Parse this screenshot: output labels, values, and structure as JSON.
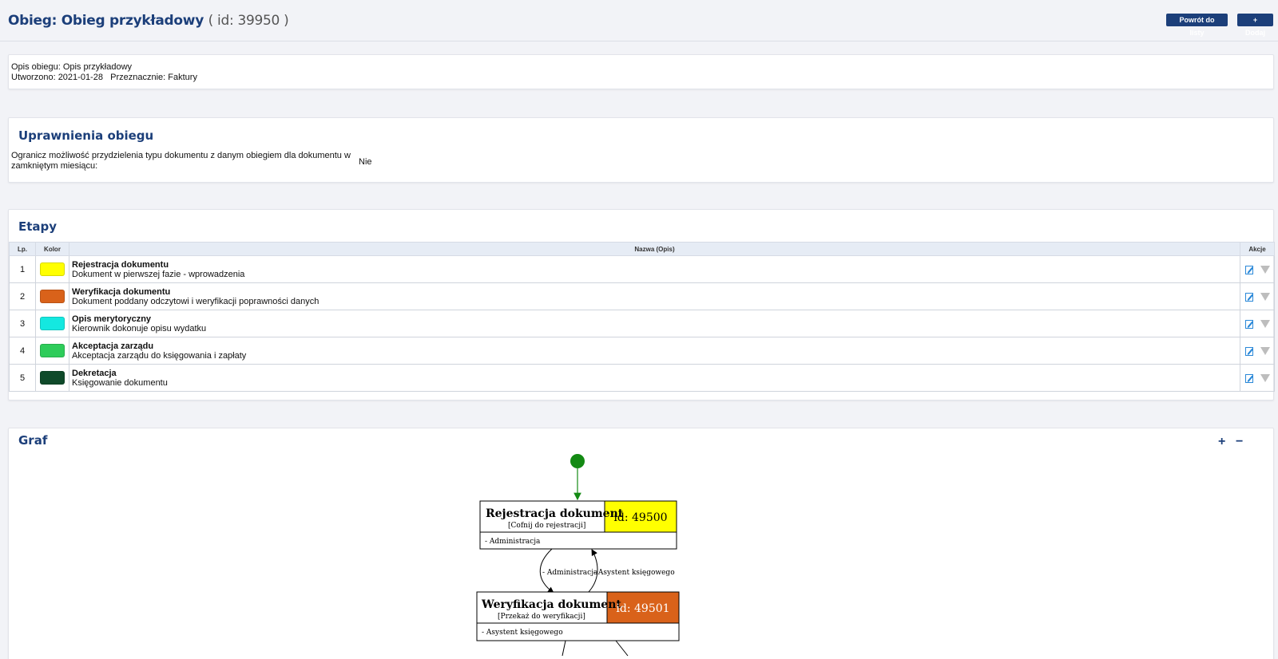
{
  "header": {
    "title_prefix": "Obieg: Obieg przykładowy",
    "title_id": "( id: 39950 )",
    "back_label": "Powrót do listy",
    "add_label": "+ Dodaj"
  },
  "info": {
    "line1": "Opis obiegu: Opis przykładowy",
    "line2": "Utworzono: 2021-01-28   Przeznacznie: Faktury"
  },
  "permissions": {
    "title": "Uprawnienia obiegu",
    "text": "Ogranicz możliwość przydzielenia typu dokumentu z danym obiegiem dla dokumentu w zamkniętym miesiącu:",
    "value": "Nie"
  },
  "etapy": {
    "title": "Etapy",
    "columns": {
      "lp": "Lp.",
      "kolor": "Kolor",
      "nazwa": "Nazwa (Opis)",
      "akcje": "Akcje"
    },
    "rows": [
      {
        "lp": "1",
        "color": "#ffff00",
        "name": "Rejestracja dokumentu",
        "desc": "Dokument w pierwszej fazie - wprowadzenia"
      },
      {
        "lp": "2",
        "color": "#d9621a",
        "name": "Weryfikacja dokumentu",
        "desc": "Dokument poddany odczytowi i weryfikacji poprawności danych"
      },
      {
        "lp": "3",
        "color": "#14e8e0",
        "name": "Opis merytoryczny",
        "desc": "Kierownik dokonuje opisu wydatku"
      },
      {
        "lp": "4",
        "color": "#2ecc5a",
        "name": "Akceptacja zarządu",
        "desc": "Akceptacja zarządu do księgowania i zapłaty"
      },
      {
        "lp": "5",
        "color": "#0f4a2a",
        "name": "Dekretacja",
        "desc": "Księgowanie dokumentu"
      }
    ]
  },
  "graf": {
    "title": "Graf",
    "zoom_in": "+",
    "zoom_out": "−",
    "nodes": [
      {
        "name": "Rejestracja dokument",
        "action": "[Cofnij do rejestracji]",
        "id_label": "id: 49500",
        "color": "#ffff00",
        "text_color": "#000000",
        "role": "- Administracja"
      },
      {
        "name": "Weryfikacja dokument",
        "action": "[Przekaż do weryfikacji]",
        "id_label": "id: 49501",
        "color": "#d9621a",
        "text_color": "#ffffff",
        "role": "- Asystent księgowego"
      }
    ],
    "edge_label_1": "- Administracja",
    "edge_label_2": "- Asystent księgowego",
    "start_color": "#138a13"
  },
  "icons": {
    "edit": "edit-icon",
    "move": "arrow-down-icon"
  }
}
